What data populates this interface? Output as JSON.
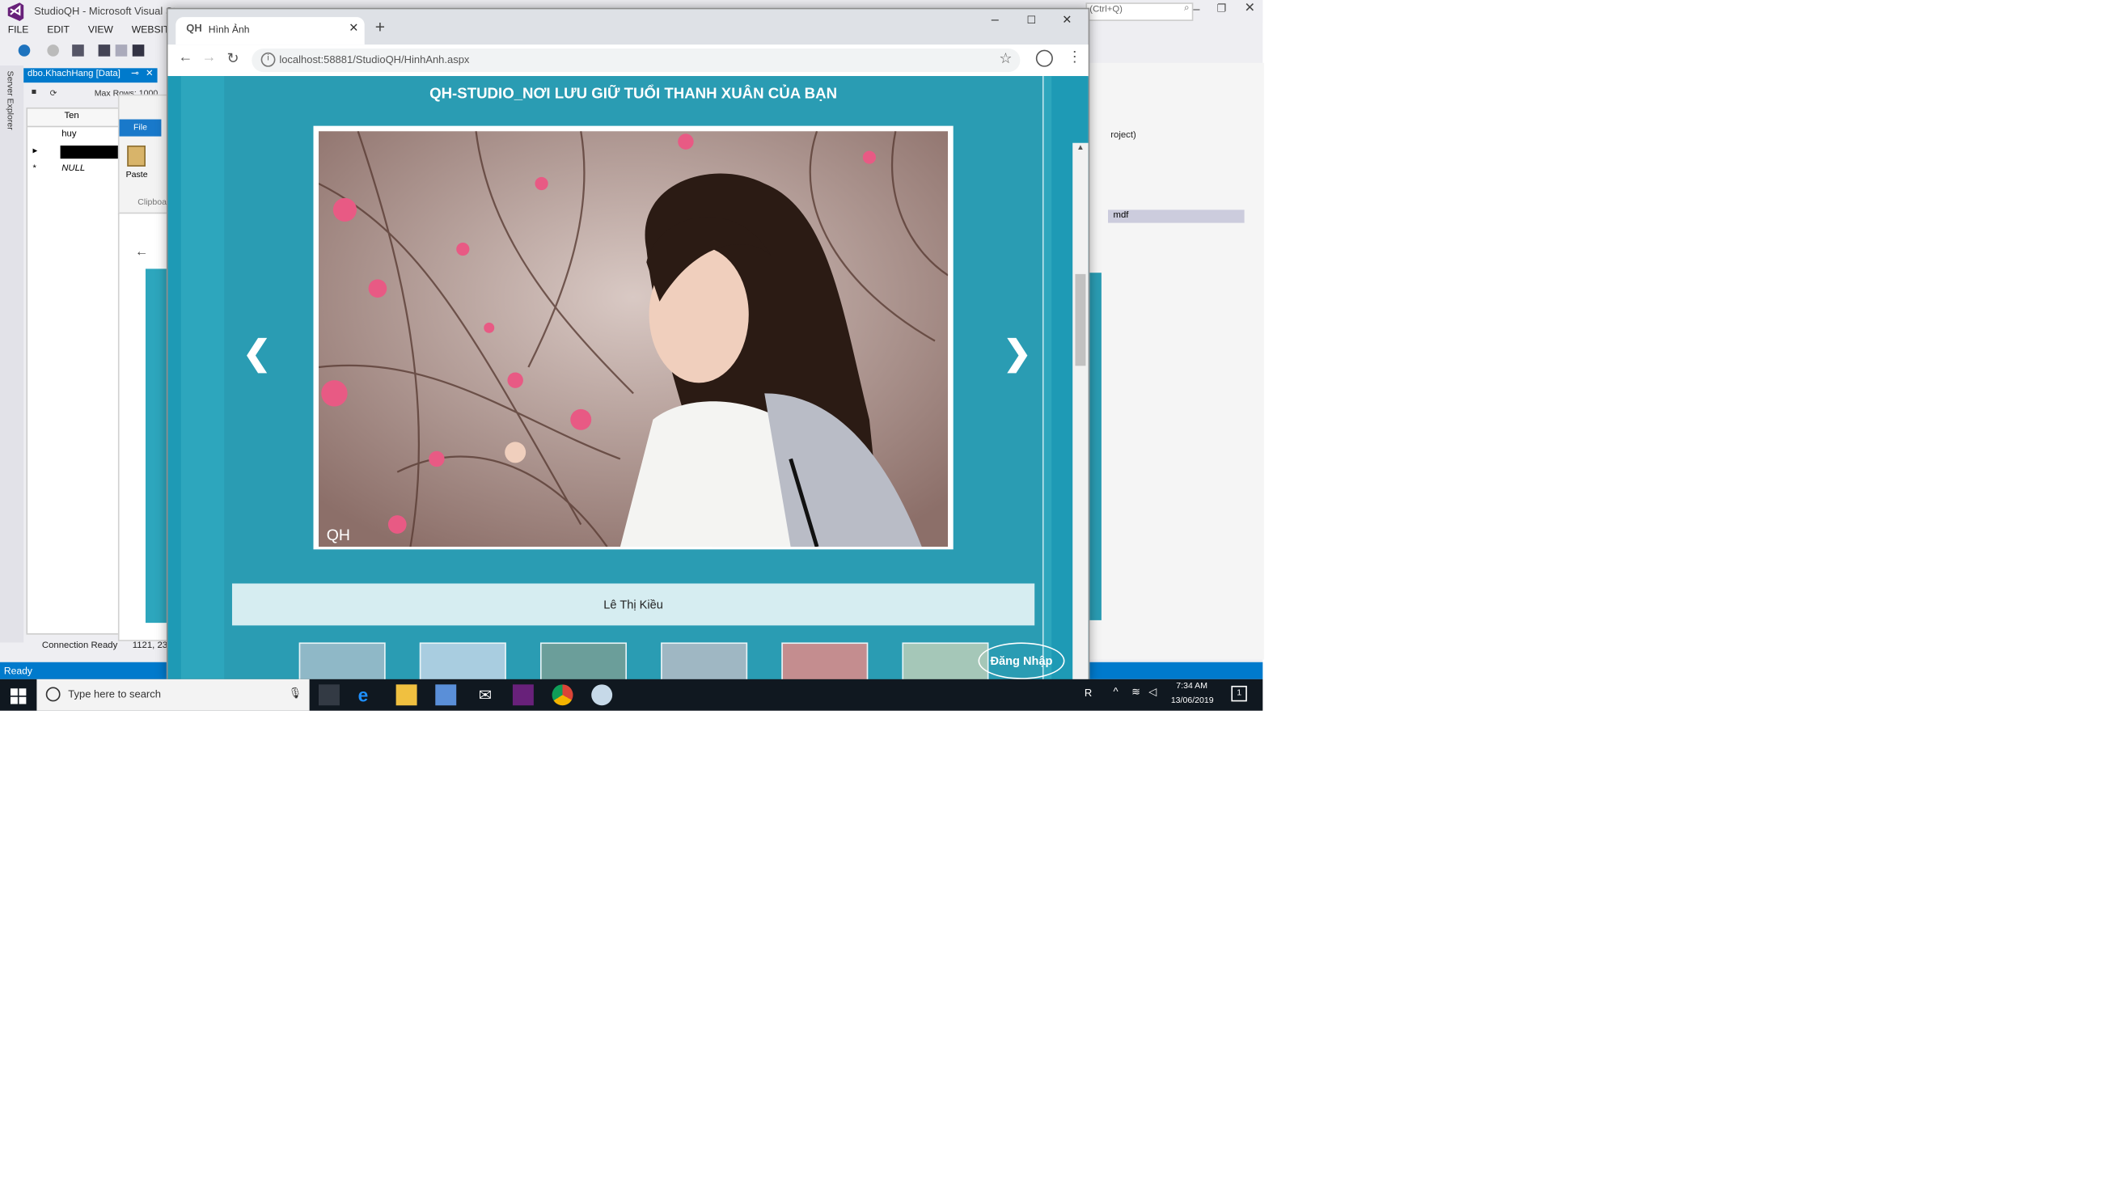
{
  "visual_studio": {
    "title": "StudioQH - Microsoft Visual Stu",
    "menu": [
      "FILE",
      "EDIT",
      "VIEW",
      "WEBSITE"
    ],
    "doc_tab": "dbo.KhachHang [Data]",
    "toolbar_max_rows": "Max Rows: 1000",
    "side_rail": "Server Explorer",
    "grid": {
      "column": "Ten",
      "rows": [
        "huy",
        "",
        "NULL"
      ]
    },
    "ribbon_file": "File",
    "ribbon_paste": "Paste",
    "ribbon_clipboard": "Clipboa",
    "search_hint": "(Ctrl+Q)",
    "solution_items": [
      "roject)",
      "mdf"
    ],
    "connection_status": "Connection Ready",
    "coords": "1121, 23",
    "status": "Ready"
  },
  "browser": {
    "tab_title": "Hình Ảnh",
    "url": "localhost:58881/StudioQH/HinhAnh.aspx"
  },
  "page": {
    "title": "QH-STUDIO_NƠI LƯU GIỮ TUỔI THANH XUÂN CỦA BẠN",
    "prev_arrow": "❮",
    "next_arrow": "❯",
    "caption": "Lê Thị Kiều",
    "login": "Đăng Nhập",
    "photo_mark": "QH"
  },
  "taskbar": {
    "search_placeholder": "Type here to search",
    "time": "7:34 AM",
    "date": "13/06/2019",
    "notification_count": "1"
  },
  "colors": {
    "page_bg": "#2a9cb3",
    "caption_bg": "#d6edf1",
    "vs_accent": "#007acc",
    "taskbar": "#101820"
  }
}
